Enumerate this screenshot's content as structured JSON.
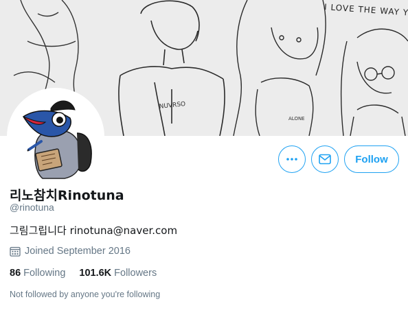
{
  "banner": {
    "handwritten_text": "I LOVE THE WAY YOU"
  },
  "profile": {
    "display_name": "리노참치Rinotuna",
    "handle": "@rinotuna",
    "bio": "그림그립니다 rinotuna@naver.com",
    "joined": "Joined September 2016",
    "following_count": "86",
    "following_label": "Following",
    "followers_count": "101.6K",
    "followers_label": "Followers",
    "follow_context": "Not followed by anyone you're following"
  },
  "actions": {
    "follow_label": "Follow",
    "more_icon": "more-dots-icon",
    "message_icon": "envelope-icon"
  },
  "colors": {
    "accent": "#1da1f2",
    "secondary_text": "#657786",
    "primary_text": "#14171a"
  }
}
